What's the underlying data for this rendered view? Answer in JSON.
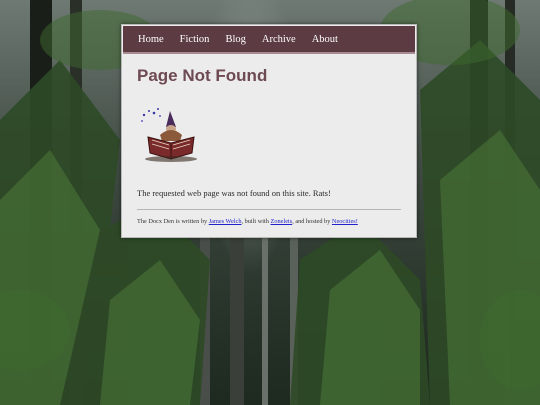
{
  "nav": {
    "items": [
      "Home",
      "Fiction",
      "Blog",
      "Archive",
      "About"
    ]
  },
  "page": {
    "title": "Page Not Found",
    "message": "The requested web page was not found on this site. Rats!"
  },
  "footer": {
    "prefix": "The Docx Den is written by ",
    "author": "James Welch",
    "mid1": ", built with ",
    "tool": "Zonelets",
    "mid2": ", and hosted by ",
    "host": "Neocities!"
  },
  "colors": {
    "nav_bg": "#5c3b42",
    "title": "#6e4a53",
    "card_bg": "#ececec",
    "link": "#2222cc"
  },
  "icons": [
    "wizard-reading-book-icon"
  ]
}
